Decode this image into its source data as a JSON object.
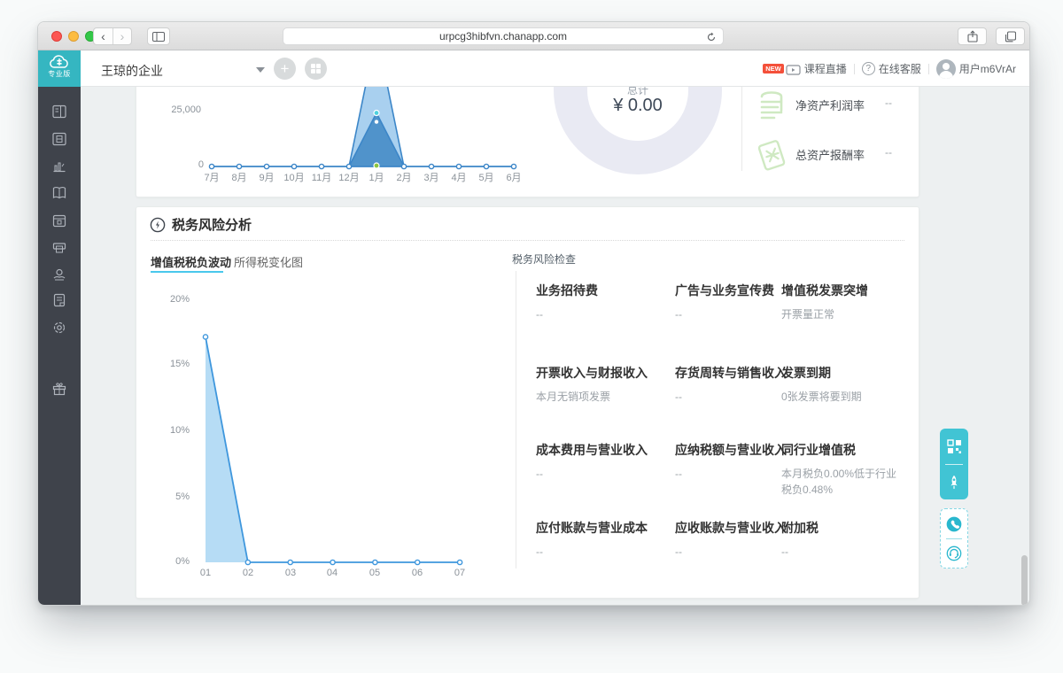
{
  "browser": {
    "url": "urpcg3hibfvn.chanapp.com"
  },
  "header": {
    "brand": "专业版",
    "company": "王琼的企业",
    "live_badge": "NEW",
    "live_label": "课程直播",
    "support_label": "在线客服",
    "user_label": "用户m6VrAr"
  },
  "sidebar": {
    "items": [
      "form",
      "voucher",
      "reports",
      "books",
      "calendar",
      "invoice",
      "funds",
      "documents",
      "settings",
      "gift"
    ]
  },
  "overview": {
    "donut_label": "总计",
    "donut_value": "¥ 0.00",
    "metrics": [
      {
        "label": "净资产利润率",
        "value": "--"
      },
      {
        "label": "总资产报酬率",
        "value": "--"
      }
    ]
  },
  "tax_section": {
    "title": "税务风险分析",
    "tabs": [
      {
        "label": "增值税税负波动",
        "active": true
      },
      {
        "label": "所得税变化图",
        "active": false
      }
    ],
    "panel_title": "税务风险检查",
    "items": [
      {
        "title": "业务招待费",
        "value": "--"
      },
      {
        "title": "广告与业务宣传费",
        "value": "--"
      },
      {
        "title": "增值税发票突增",
        "value": "开票量正常"
      },
      {
        "title": "开票收入与财报收入",
        "value": "本月无销项发票"
      },
      {
        "title": "存货周转与销售收入",
        "value": "--"
      },
      {
        "title": "发票到期",
        "value": "0张发票将要到期"
      },
      {
        "title": "成本费用与营业收入",
        "value": "--"
      },
      {
        "title": "应纳税额与营业收入",
        "value": "--"
      },
      {
        "title": "同行业增值税",
        "value": "本月税负0.00%低于行业税负0.48%"
      },
      {
        "title": "应付账款与营业成本",
        "value": "--"
      },
      {
        "title": "应收账款与营业收入",
        "value": "--"
      },
      {
        "title": "附加税",
        "value": "--"
      }
    ]
  },
  "chart_data": [
    {
      "type": "area",
      "title": "",
      "categories": [
        "7月",
        "8月",
        "9月",
        "10月",
        "11月",
        "12月",
        "1月",
        "2月",
        "3月",
        "4月",
        "5月",
        "6月"
      ],
      "series": [
        {
          "name": "",
          "values": [
            0,
            0,
            0,
            0,
            0,
            0,
            60000,
            0,
            0,
            0,
            0,
            0
          ]
        },
        {
          "name": "",
          "values": [
            0,
            0,
            0,
            0,
            0,
            0,
            24000,
            0,
            0,
            0,
            0,
            0
          ]
        }
      ],
      "ylim": [
        0,
        25000
      ],
      "yticks": [
        "25,000",
        "0"
      ],
      "peak_clipped_at_top": true,
      "highlight_index": 6,
      "legend": "none",
      "grid": "off"
    },
    {
      "type": "area",
      "title": "增值税税负波动",
      "categories": [
        "01",
        "02",
        "03",
        "04",
        "05",
        "06",
        "07"
      ],
      "values": [
        17.2,
        0,
        0,
        0,
        0,
        0,
        0
      ],
      "ylim": [
        0,
        20
      ],
      "yticks": [
        "20%",
        "15%",
        "10%",
        "5%",
        "0%"
      ],
      "ylabel": "",
      "xlabel": "",
      "legend": "none",
      "grid": "off"
    },
    {
      "type": "donut",
      "label": "总计",
      "value": "¥ 0.00",
      "segments": [
        {
          "value": 100,
          "color": "#e9eaf3"
        }
      ]
    }
  ],
  "colors": {
    "accent_teal": "#35b6c1",
    "chart_blue": "#3c86c8",
    "chart_fill_light": "#a6cdea",
    "tab_underline": "#49c8ec",
    "green_marker": "#8bc540",
    "icon_green": "#cfe9c2",
    "badge_red": "#f4503a"
  }
}
